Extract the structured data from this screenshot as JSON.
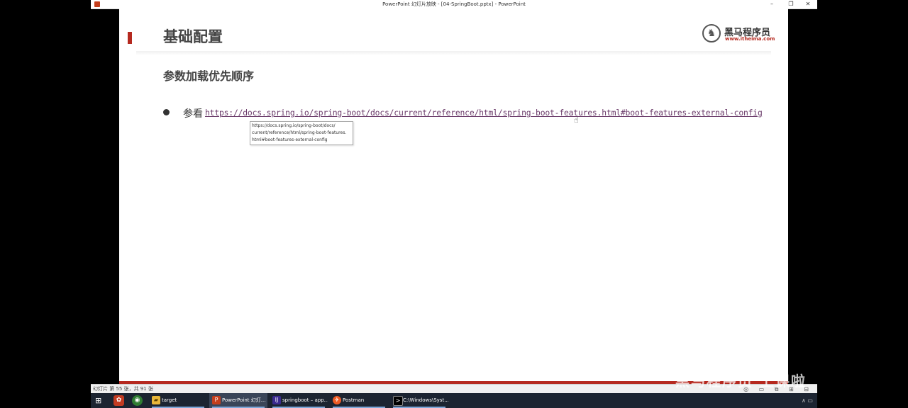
{
  "window": {
    "title": "PowerPoint 幻灯片放映 - [04-SpringBoot.pptx] - PowerPoint",
    "minimize": "–",
    "restore": "❐",
    "close": "✕"
  },
  "slide": {
    "title": "基础配置",
    "subtitle": "参数加载优先顺序",
    "bullet_label": "参看",
    "link_text": "https://docs.spring.io/spring-boot/docs/current/reference/html/spring-boot-features.html#boot-features-external-config",
    "tooltip_text": "https://docs.spring.io/spring-boot/docs/\ncurrent/reference/html/spring-boot-features.\nhtml#boot-features-external-config",
    "logo": {
      "name": "黑马程序员",
      "url": "www.itheima.com"
    }
  },
  "statusbar": {
    "slide_count": "幻灯片 第 55 张，共 91 张",
    "view_icons": "◎ ▭ ⧉ ⊞ ⊟"
  },
  "watermark": "黑马程序员 上课啦",
  "taskbar": {
    "items": [
      {
        "label": "target",
        "icon": "folder-icon"
      },
      {
        "label": "PowerPoint 幻灯...",
        "icon": "powerpoint-icon"
      },
      {
        "label": "springboot – app...",
        "icon": "intellij-icon"
      },
      {
        "label": "Postman",
        "icon": "postman-icon"
      },
      {
        "label": "C:\\Windows\\Syst...",
        "icon": "cmd-icon"
      }
    ],
    "tray": "∧  ▭"
  },
  "colors": {
    "accent": "#b5291f",
    "link": "#6b3b6a",
    "taskbar": "#1c2431"
  }
}
